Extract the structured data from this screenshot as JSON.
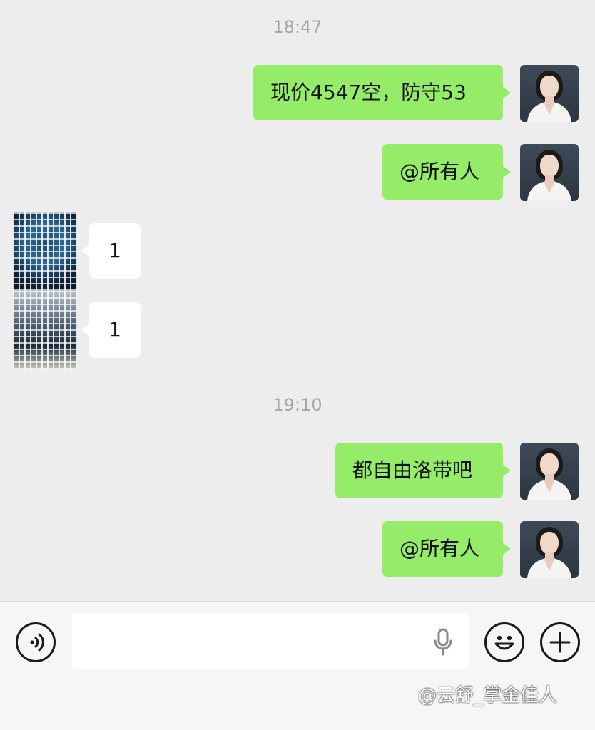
{
  "chat": {
    "time_1": "18:47",
    "time_2": "19:10",
    "messages": [
      {
        "from": "me",
        "text": "现价4547空，防守53"
      },
      {
        "from": "me",
        "text": "@所有人"
      },
      {
        "from": "other",
        "text": "1"
      },
      {
        "from": "other",
        "text": "1"
      },
      {
        "from": "me",
        "text": "都自由洛带吧"
      },
      {
        "from": "me",
        "text": "@所有人"
      }
    ]
  },
  "input_bar": {
    "placeholder": "",
    "icons": [
      "voice-icon",
      "microphone-icon",
      "emoji-icon",
      "plus-icon"
    ]
  },
  "watermark": "@云舒_掌金佳人",
  "colors": {
    "background": "#ededed",
    "my_bubble": "#95ec69",
    "other_bubble": "#ffffff",
    "input_bar": "#f6f6f6"
  }
}
